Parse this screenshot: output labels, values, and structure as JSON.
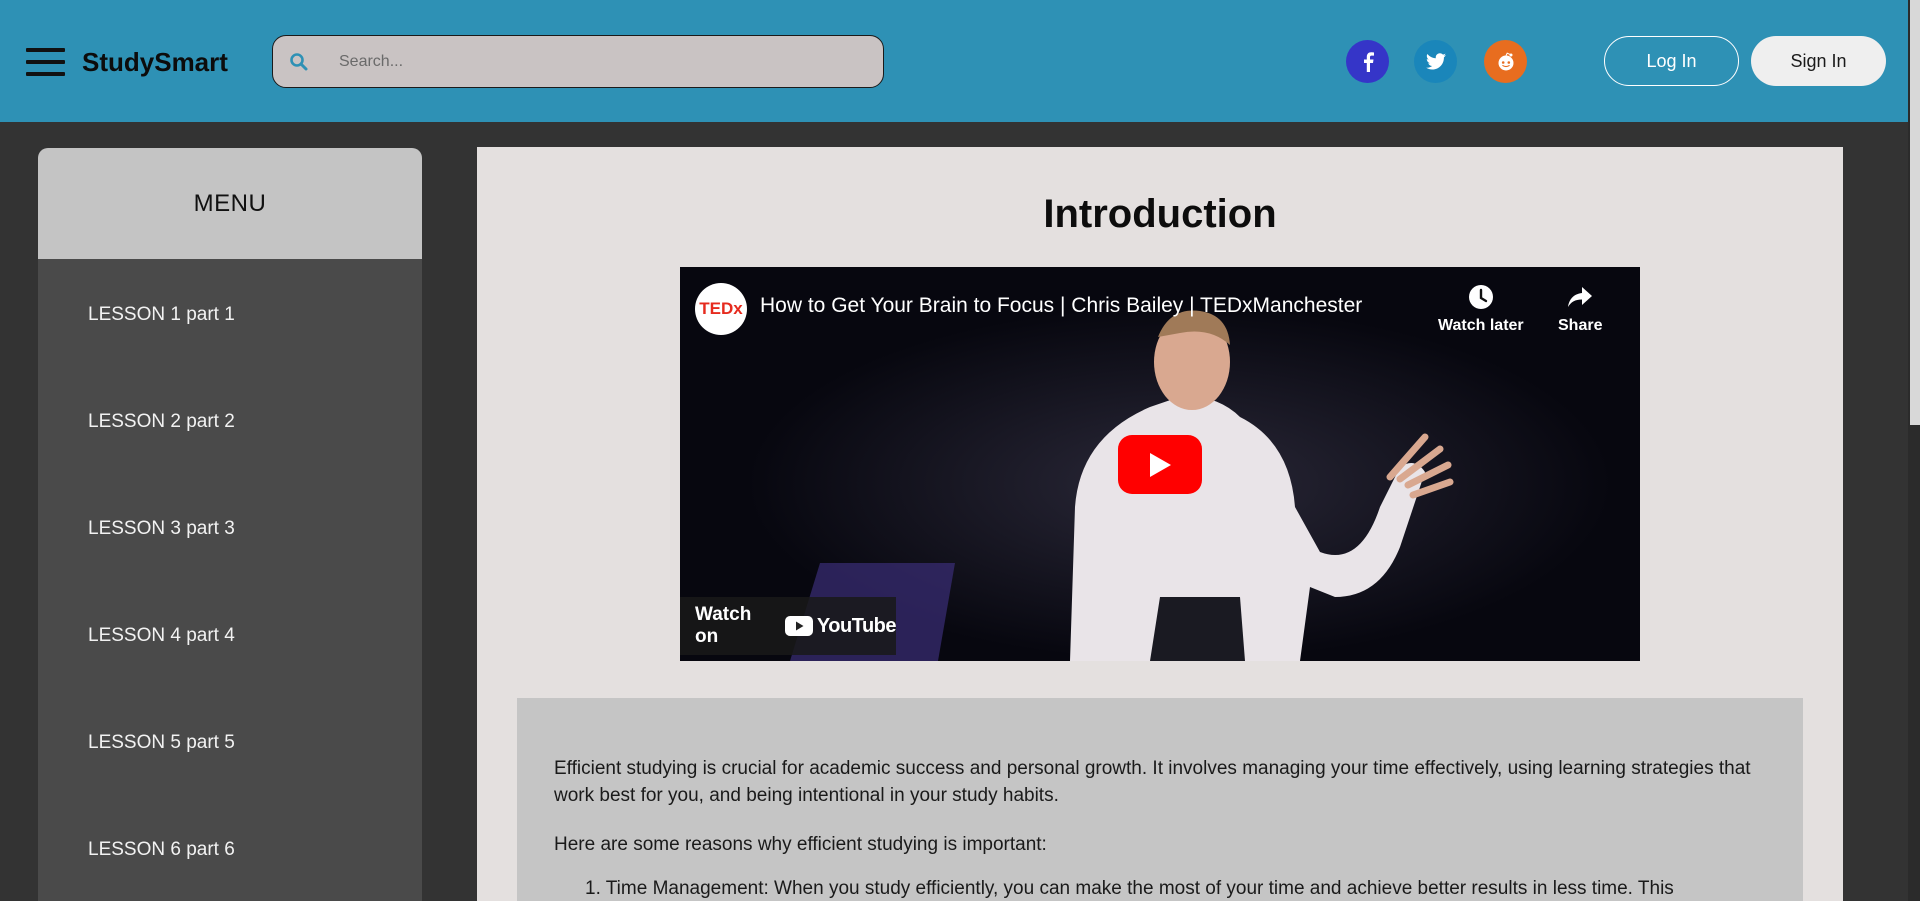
{
  "header": {
    "brand": "StudySmart",
    "search_placeholder": "Search...",
    "social": [
      "facebook-icon",
      "twitter-icon",
      "reddit-icon"
    ],
    "login_label": "Log In",
    "signin_label": "Sign In",
    "bg_color": "#2e91b5"
  },
  "sidebar": {
    "heading": "MENU",
    "items": [
      {
        "label": "LESSON 1 part 1"
      },
      {
        "label": "LESSON 2 part 2"
      },
      {
        "label": "LESSON 3 part 3"
      },
      {
        "label": "LESSON 4 part 4"
      },
      {
        "label": "LESSON 5 part 5"
      },
      {
        "label": "LESSON 6 part 6"
      }
    ]
  },
  "main": {
    "title": "Introduction",
    "video": {
      "channel_logo": "TEDx",
      "title": "How to Get Your Brain to Focus | Chris Bailey | TEDxManchester",
      "watch_later": "Watch later",
      "share": "Share",
      "watch_on": "Watch on",
      "platform": "YouTube"
    },
    "content": {
      "paragraph1": "Efficient studying is crucial for academic success and personal growth. It involves managing your time effectively, using learning strategies that work best for you, and being intentional in your study habits.",
      "paragraph2": "Here are some reasons why efficient studying is important:",
      "list": [
        "1. Time Management: When you study efficiently, you can make the most of your time and achieve better results in less time. This"
      ]
    }
  }
}
